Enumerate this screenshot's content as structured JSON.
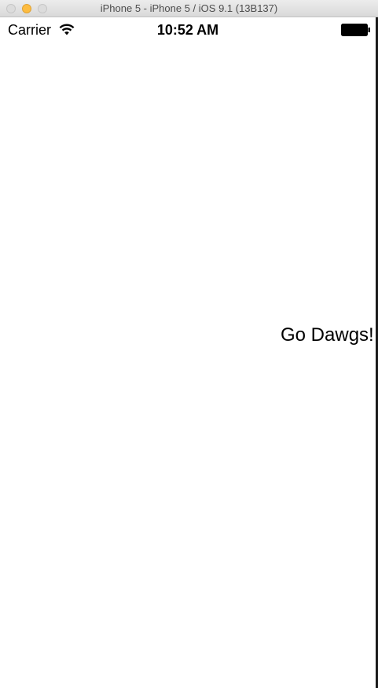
{
  "window": {
    "title": "iPhone 5 - iPhone 5 / iOS 9.1 (13B137)"
  },
  "status_bar": {
    "carrier": "Carrier",
    "time": "10:52 AM",
    "icons": [
      "wifi-icon",
      "battery-icon"
    ]
  },
  "main": {
    "label": "Go Dawgs!"
  },
  "colors": {
    "minimize_button": "#fdbc40",
    "background": "#ffffff",
    "text": "#000000"
  }
}
